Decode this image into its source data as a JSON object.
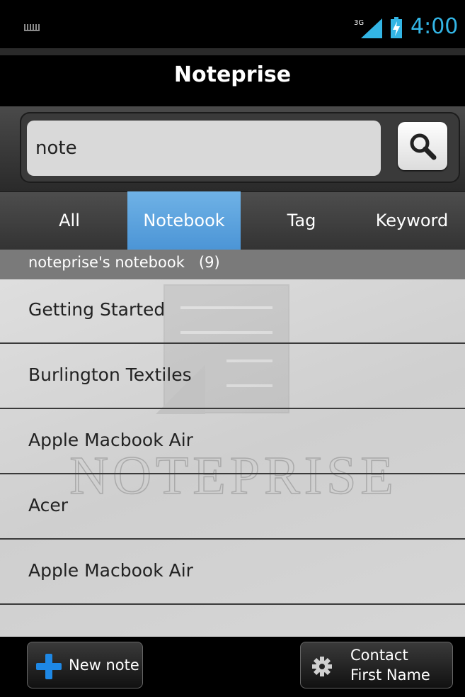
{
  "status_bar": {
    "network": "3G",
    "time": "4:00",
    "icons": [
      "keyboard-icon",
      "signal-icon",
      "battery-icon"
    ]
  },
  "app": {
    "title": "Noteprise"
  },
  "search": {
    "value": "note",
    "button_icon": "search-icon"
  },
  "tabs": [
    {
      "label": "All",
      "active": false
    },
    {
      "label": "Notebook",
      "active": true
    },
    {
      "label": "Tag",
      "active": false
    },
    {
      "label": "Keyword",
      "active": false
    }
  ],
  "group": {
    "label": "noteprise's notebook   (9)"
  },
  "notes": [
    {
      "title": "Getting Started"
    },
    {
      "title": "Burlington Textiles"
    },
    {
      "title": "Apple Macbook Air"
    },
    {
      "title": "Acer"
    },
    {
      "title": "Apple Macbook Air"
    }
  ],
  "watermark_text": "NOTEPRISE",
  "bottom_bar": {
    "new_note_label": "New note",
    "contact_line1": "Contact",
    "contact_line2": "First Name"
  },
  "colors": {
    "accent": "#33b5e5",
    "active_tab": "#5aa2dc",
    "plus": "#1e88e5"
  }
}
